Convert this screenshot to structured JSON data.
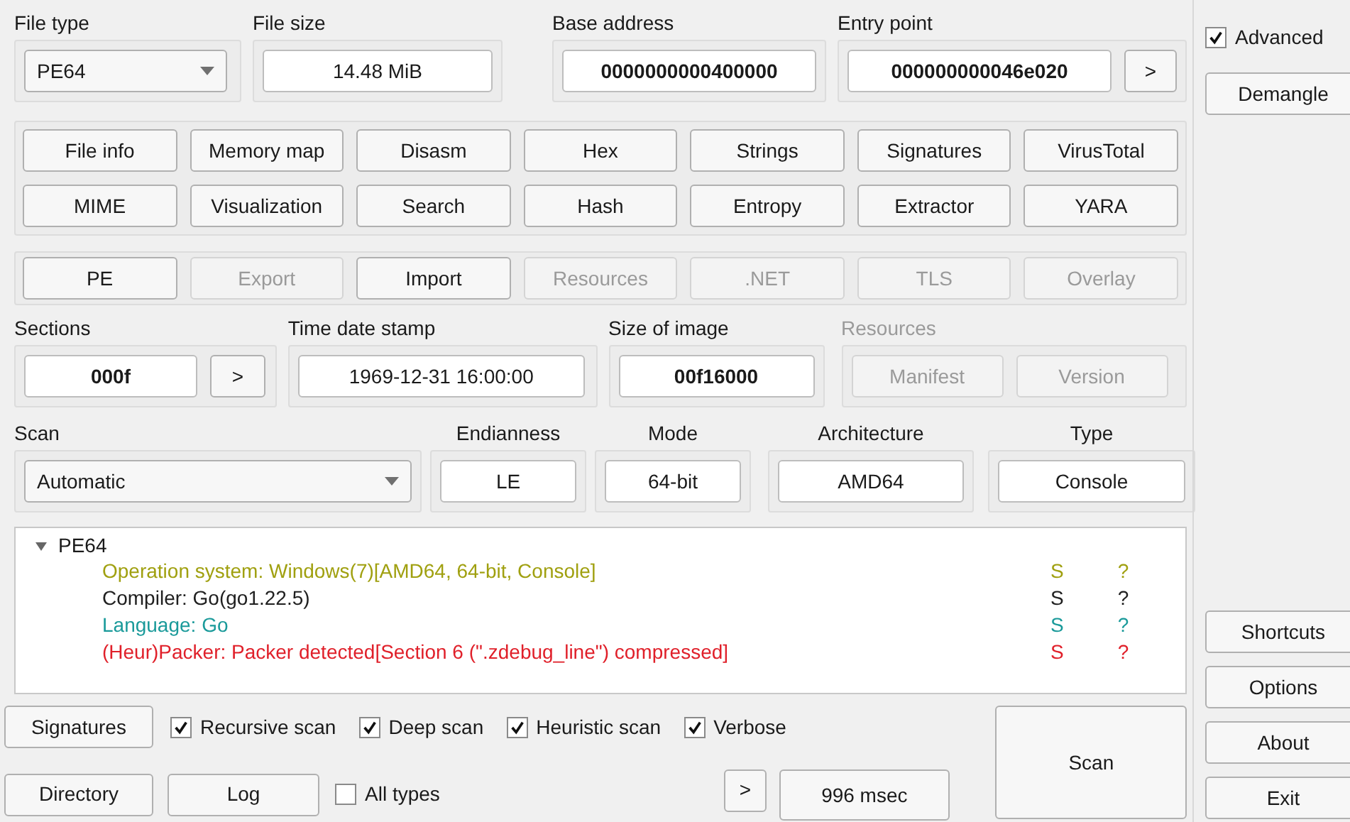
{
  "file_type": {
    "label": "File type",
    "value": "PE64"
  },
  "file_size": {
    "label": "File size",
    "value": "14.48 MiB"
  },
  "base_address": {
    "label": "Base address",
    "value": "0000000000400000"
  },
  "entry_point": {
    "label": "Entry point",
    "value": "000000000046e020",
    "button": ">"
  },
  "tool_buttons": [
    {
      "label": "File info"
    },
    {
      "label": "Memory map"
    },
    {
      "label": "Disasm"
    },
    {
      "label": "Hex"
    },
    {
      "label": "Strings"
    },
    {
      "label": "Signatures"
    },
    {
      "label": "VirusTotal"
    },
    {
      "label": "MIME"
    },
    {
      "label": "Visualization"
    },
    {
      "label": "Search"
    },
    {
      "label": "Hash"
    },
    {
      "label": "Entropy"
    },
    {
      "label": "Extractor"
    },
    {
      "label": "YARA"
    }
  ],
  "pe_buttons": [
    {
      "label": "PE",
      "disabled": false
    },
    {
      "label": "Export",
      "disabled": true
    },
    {
      "label": "Import",
      "disabled": false
    },
    {
      "label": "Resources",
      "disabled": true
    },
    {
      "label": ".NET",
      "disabled": true
    },
    {
      "label": "TLS",
      "disabled": true
    },
    {
      "label": "Overlay",
      "disabled": true
    }
  ],
  "sections": {
    "label": "Sections",
    "value": "000f",
    "button": ">"
  },
  "time_date_stamp": {
    "label": "Time date stamp",
    "value": "1969-12-31 16:00:00"
  },
  "size_of_image": {
    "label": "Size of image",
    "value": "00f16000"
  },
  "resources": {
    "label": "Resources",
    "disabled": true,
    "buttons": [
      {
        "label": "Manifest",
        "disabled": true
      },
      {
        "label": "Version",
        "disabled": true
      }
    ]
  },
  "scan": {
    "label": "Scan",
    "value": "Automatic"
  },
  "endianness": {
    "label": "Endianness",
    "value": "LE"
  },
  "mode": {
    "label": "Mode",
    "value": "64-bit"
  },
  "architecture": {
    "label": "Architecture",
    "value": "AMD64"
  },
  "type": {
    "label": "Type",
    "value": "Console"
  },
  "results": {
    "root": "PE64",
    "expanded": true,
    "children": [
      {
        "text": "Operation system: Windows(7)[AMD64, 64-bit, Console]",
        "color": "#a0a010",
        "column_2": "S",
        "column_3": "?"
      },
      {
        "text": "Compiler: Go(go1.22.5)",
        "color": "#202020",
        "column_2": "S",
        "column_3": "?"
      },
      {
        "text": "Language: Go",
        "color": "#1a9a9a",
        "column_2": "S",
        "column_3": "?"
      },
      {
        "text": "(Heur)Packer: Packer detected[Section 6 (\".zdebug_line\") compressed]",
        "color": "#e0202a",
        "column_2": "S",
        "column_3": "?"
      }
    ]
  },
  "signatures_button": "Signatures",
  "scan_options": [
    {
      "label": "Recursive scan",
      "checked": true
    },
    {
      "label": "Deep scan",
      "checked": true
    },
    {
      "label": "Heuristic scan",
      "checked": true
    },
    {
      "label": "Verbose",
      "checked": true
    }
  ],
  "directory_button": "Directory",
  "log_button": "Log",
  "all_types": {
    "label": "All types",
    "checked": false
  },
  "more_button": ">",
  "elapsed": "996 msec",
  "scan_button": "Scan",
  "advanced": {
    "label": "Advanced",
    "checked": true
  },
  "demangle_button": "Demangle",
  "side_buttons": [
    {
      "label": "Shortcuts"
    },
    {
      "label": "Options"
    },
    {
      "label": "About"
    },
    {
      "label": "Exit"
    }
  ]
}
